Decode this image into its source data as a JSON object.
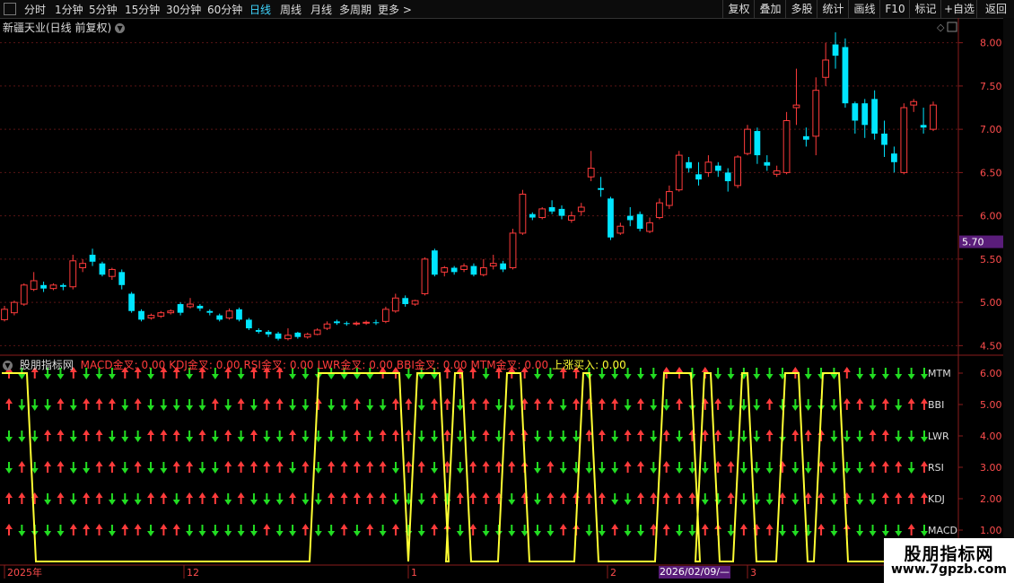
{
  "toolbar": {
    "timeframes": [
      "分时",
      "1分钟",
      "5分钟",
      "15分钟",
      "30分钟",
      "60分钟",
      "日线",
      "周线",
      "月线",
      "多周期",
      "更多 >"
    ],
    "active": "日线",
    "buttons": [
      "复权",
      "叠加",
      "多股",
      "统计",
      "画线",
      "F10",
      "标记",
      "+自选",
      "返回"
    ]
  },
  "chart_title": "新疆天业(日线 前复权)",
  "price_axis": [
    "8.00",
    "7.50",
    "7.00",
    "6.50",
    "6.00",
    "5.50",
    "5.00",
    "4.50"
  ],
  "price_marker": "5.70",
  "indicator": {
    "name": "股朋指标网",
    "readouts": [
      {
        "label": "MACD金叉: 0.00",
        "color": "#ff3b3b"
      },
      {
        "label": "KDJ金叉: 0.00",
        "color": "#ff3b3b"
      },
      {
        "label": "RSI金叉: 0.00",
        "color": "#ff3b3b"
      },
      {
        "label": "LWR金叉: 0.00",
        "color": "#ff3b3b"
      },
      {
        "label": "BBI金叉: 0.00",
        "color": "#ff3b3b"
      },
      {
        "label": "MTM金叉: 0.00",
        "color": "#ff3b3b"
      },
      {
        "label": "上涨买入: 0.00",
        "color": "#ffff33"
      }
    ],
    "axis": [
      "6.00",
      "5.00",
      "4.00",
      "3.00",
      "2.00",
      "1.00"
    ],
    "row_labels": [
      "MTM",
      "BBI",
      "LWR",
      "RSI",
      "KDJ",
      "MACD"
    ]
  },
  "time_axis": [
    "2025年",
    "12",
    "1",
    "2",
    "3"
  ],
  "crosshair_date": "2026/02/09/—",
  "brand": {
    "name": "股朋指标网",
    "url": "www.7gpzb.com"
  },
  "colors": {
    "up": "#ff3b3b",
    "down": "#00e5ff",
    "buy_line": "#ffff33",
    "arrow_down": "#22dd22"
  },
  "chart_data": {
    "type": "candlestick",
    "ylim": [
      4.4,
      8.1
    ],
    "candles": [
      [
        4.8,
        4.92,
        4.78,
        4.96
      ],
      [
        4.88,
        5.0,
        4.85,
        5.02
      ],
      [
        4.98,
        5.2,
        4.96,
        5.22
      ],
      [
        5.15,
        5.25,
        5.13,
        5.35
      ],
      [
        5.2,
        5.16,
        5.12,
        5.24
      ],
      [
        5.16,
        5.2,
        5.14,
        5.22
      ],
      [
        5.2,
        5.18,
        5.14,
        5.22
      ],
      [
        5.18,
        5.48,
        5.15,
        5.55
      ],
      [
        5.4,
        5.45,
        5.35,
        5.5
      ],
      [
        5.55,
        5.47,
        5.42,
        5.62
      ],
      [
        5.45,
        5.32,
        5.3,
        5.47
      ],
      [
        5.3,
        5.38,
        5.26,
        5.4
      ],
      [
        5.35,
        5.2,
        5.15,
        5.38
      ],
      [
        5.1,
        4.9,
        4.88,
        5.12
      ],
      [
        4.9,
        4.8,
        4.78,
        4.92
      ],
      [
        4.82,
        4.85,
        4.8,
        4.87
      ],
      [
        4.84,
        4.88,
        4.82,
        4.9
      ],
      [
        4.88,
        4.9,
        4.86,
        4.92
      ],
      [
        4.98,
        4.88,
        4.85,
        5.0
      ],
      [
        4.95,
        4.98,
        4.93,
        5.05
      ],
      [
        4.96,
        4.93,
        4.9,
        4.98
      ],
      [
        4.9,
        4.88,
        4.85,
        4.92
      ],
      [
        4.85,
        4.8,
        4.78,
        4.87
      ],
      [
        4.82,
        4.9,
        4.8,
        4.93
      ],
      [
        4.92,
        4.8,
        4.78,
        4.94
      ],
      [
        4.8,
        4.7,
        4.68,
        4.82
      ],
      [
        4.68,
        4.66,
        4.64,
        4.7
      ],
      [
        4.66,
        4.63,
        4.6,
        4.68
      ],
      [
        4.64,
        4.58,
        4.56,
        4.66
      ],
      [
        4.58,
        4.62,
        4.56,
        4.7
      ],
      [
        4.65,
        4.6,
        4.58,
        4.66
      ],
      [
        4.6,
        4.63,
        4.58,
        4.65
      ],
      [
        4.63,
        4.68,
        4.62,
        4.7
      ],
      [
        4.7,
        4.75,
        4.68,
        4.78
      ],
      [
        4.78,
        4.76,
        4.74,
        4.8
      ],
      [
        4.76,
        4.75,
        4.73,
        4.78
      ],
      [
        4.75,
        4.76,
        4.73,
        4.78
      ],
      [
        4.76,
        4.77,
        4.74,
        4.79
      ],
      [
        4.77,
        4.76,
        4.74,
        4.8
      ],
      [
        4.78,
        4.92,
        4.76,
        4.95
      ],
      [
        4.9,
        5.05,
        4.88,
        5.1
      ],
      [
        5.05,
        4.98,
        4.95,
        5.08
      ],
      [
        4.98,
        5.02,
        4.96,
        5.03
      ],
      [
        5.1,
        5.5,
        5.08,
        5.52
      ],
      [
        5.6,
        5.32,
        5.3,
        5.62
      ],
      [
        5.35,
        5.4,
        5.3,
        5.42
      ],
      [
        5.4,
        5.35,
        5.32,
        5.42
      ],
      [
        5.38,
        5.42,
        5.35,
        5.45
      ],
      [
        5.42,
        5.32,
        5.3,
        5.45
      ],
      [
        5.32,
        5.4,
        5.3,
        5.5
      ],
      [
        5.42,
        5.45,
        5.38,
        5.55
      ],
      [
        5.45,
        5.38,
        5.35,
        5.48
      ],
      [
        5.4,
        5.8,
        5.38,
        5.85
      ],
      [
        5.8,
        6.25,
        5.78,
        6.3
      ],
      [
        6.02,
        5.98,
        5.95,
        6.04
      ],
      [
        5.98,
        6.08,
        5.96,
        6.1
      ],
      [
        6.1,
        6.05,
        6.02,
        6.18
      ],
      [
        6.08,
        6.0,
        5.96,
        6.12
      ],
      [
        5.95,
        6.0,
        5.92,
        6.05
      ],
      [
        6.05,
        6.1,
        6.0,
        6.15
      ],
      [
        6.45,
        6.55,
        6.4,
        6.75
      ],
      [
        6.32,
        6.3,
        6.22,
        6.45
      ],
      [
        6.2,
        5.75,
        5.72,
        6.22
      ],
      [
        5.8,
        5.88,
        5.78,
        5.92
      ],
      [
        6.0,
        5.95,
        5.88,
        6.1
      ],
      [
        6.02,
        5.85,
        5.82,
        6.05
      ],
      [
        5.82,
        5.92,
        5.8,
        5.98
      ],
      [
        5.98,
        6.15,
        5.96,
        6.2
      ],
      [
        6.12,
        6.28,
        6.08,
        6.35
      ],
      [
        6.3,
        6.7,
        6.28,
        6.75
      ],
      [
        6.62,
        6.55,
        6.5,
        6.68
      ],
      [
        6.48,
        6.42,
        6.35,
        6.62
      ],
      [
        6.5,
        6.62,
        6.45,
        6.7
      ],
      [
        6.58,
        6.52,
        6.45,
        6.62
      ],
      [
        6.5,
        6.4,
        6.28,
        6.55
      ],
      [
        6.35,
        6.68,
        6.32,
        6.7
      ],
      [
        6.72,
        7.0,
        6.7,
        7.05
      ],
      [
        6.98,
        6.7,
        6.6,
        7.02
      ],
      [
        6.62,
        6.58,
        6.52,
        6.7
      ],
      [
        6.48,
        6.52,
        6.45,
        6.58
      ],
      [
        6.5,
        7.1,
        6.48,
        7.2
      ],
      [
        7.25,
        7.28,
        7.05,
        7.7
      ],
      [
        6.92,
        6.88,
        6.8,
        7.02
      ],
      [
        6.92,
        7.45,
        6.7,
        7.6
      ],
      [
        7.6,
        7.8,
        7.5,
        8.0
      ],
      [
        7.98,
        7.85,
        7.7,
        8.12
      ],
      [
        7.95,
        7.3,
        7.25,
        8.05
      ],
      [
        7.3,
        7.1,
        6.95,
        7.32
      ],
      [
        7.3,
        7.05,
        6.9,
        7.35
      ],
      [
        7.35,
        6.95,
        6.88,
        7.45
      ],
      [
        6.95,
        6.82,
        6.68,
        7.1
      ],
      [
        6.72,
        6.62,
        6.5,
        6.8
      ],
      [
        6.5,
        7.25,
        6.48,
        7.3
      ],
      [
        7.28,
        7.32,
        7.2,
        7.35
      ],
      [
        7.05,
        7.02,
        6.95,
        7.25
      ],
      [
        7.0,
        7.28,
        6.98,
        7.32
      ]
    ]
  }
}
